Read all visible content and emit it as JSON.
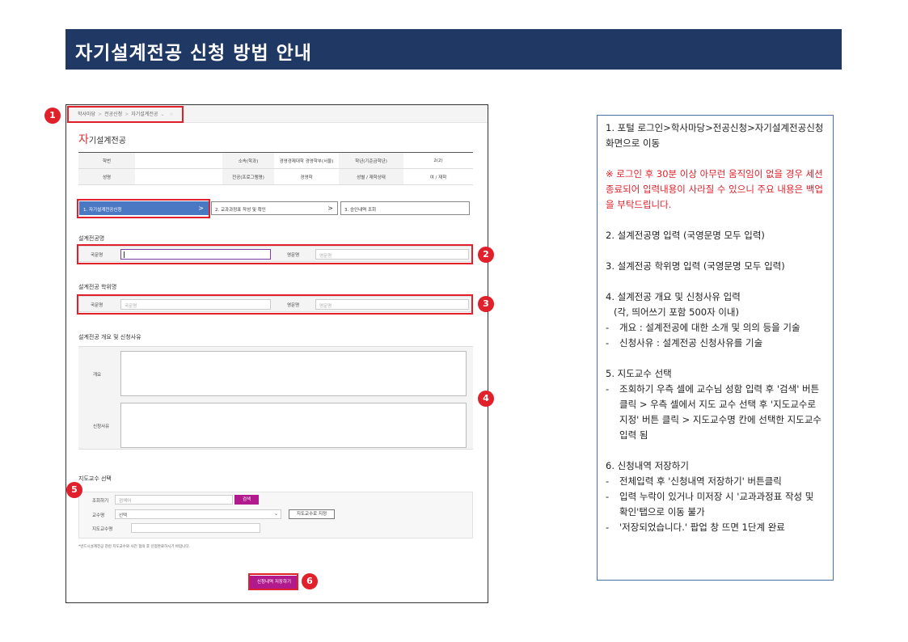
{
  "banner": {
    "title": "자기설계전공 신청 방법 안내"
  },
  "screenshot": {
    "breadcrumb": [
      "학사마당",
      "전공신청",
      "자기설계전공"
    ],
    "page_title": {
      "first": "자",
      "rest": "기설계전공"
    },
    "info": {
      "student_id_label": "학번",
      "affiliation_label": "소속(학과)",
      "affiliation_value": "경영경제대학 경영학부(서울)",
      "grade_label": "학년(기준금학년)",
      "grade_value": "2(2)",
      "name_label": "성명",
      "major_label": "전공(프로그램명)",
      "major_value": "경영학",
      "gender_label": "성별 / 재학상태",
      "gender_value": "여 / 재학"
    },
    "steps": [
      {
        "label": "1. 자기설계전공신청",
        "arrow": ">"
      },
      {
        "label": "2. 교과과정표 작성 및 확인",
        "arrow": ">"
      },
      {
        "label": "3. 승인내역 조회"
      }
    ],
    "major_name": {
      "section": "설계전공명",
      "kor_label": "국문명",
      "kor_value": "",
      "eng_label": "영문명",
      "eng_placeholder": "영문명"
    },
    "degree_name": {
      "section": "설계전공 학위명",
      "kor_label": "국문명",
      "kor_placeholder": "국문명",
      "eng_label": "영문명",
      "eng_placeholder": "영문명"
    },
    "overview": {
      "section": "설계전공 개요 및 신청사유",
      "overview_label": "개요",
      "reason_label": "신청사유"
    },
    "advisor": {
      "section": "지도교수 선택",
      "search_label": "조회하기",
      "search_placeholder": "검색어",
      "search_button": "검색",
      "professor_label": "교수명",
      "professor_select": "선택",
      "assign_button": "지도교수로 지정",
      "advisor_label": "지도교수명"
    },
    "note": "*반드시설계전공 관련 지도교수와 사전 협의 후 신청완료하시기 바랍니다.",
    "save_button": "신청내역 저장하기"
  },
  "badges": [
    "1",
    "2",
    "3",
    "4",
    "5",
    "6"
  ],
  "guide": {
    "s1": "1. 포털 로그인>학사마당>전공신청>자기설계전공신청 화면으로 이동",
    "warning": "※ 로그인 후 30분 이상 아무런 움직임이 없을 경우 세션 종료되어 입력내용이 사라질 수 있으니 주요 내용은 백업을 부탁드립니다.",
    "s2": "2. 설계전공명 입력 (국영문명 모두 입력)",
    "s3": "3. 설계전공 학위명 입력 (국영문명 모두 입력)",
    "s4_title": "4. 설계전공 개요 및 신청사유 입력",
    "s4_note": "(각, 띄어쓰기 포함 500자 이내)",
    "s4_b1": "개요 :  설계전공에 대한 소개 및 의의 등을 기술",
    "s4_b2": "신청사유 : 설계전공 신청사유를 기술",
    "s5_title": "5. 지도교수 선택",
    "s5_b1": "조회하기 우측 셀에 교수님 성함 입력 후 '검색' 버튼 클릭 > 우측 셀에서 지도 교수 선택 후 '지도교수로 지정' 버튼 클릭 > 지도교수명 칸에 선택한 지도교수 입력 됨",
    "s6_title": "6. 신청내역 저장하기",
    "s6_b1": "전체입력 후 '신청내역 저장하기' 버튼클릭",
    "s6_b2": "입력 누락이 있거나 미저장 시 '교과과정표 작성 및 확인'탭으로 이동 불가",
    "s6_b3": "'저장되었습니다.' 팝업 창 뜨면 1단계 완료",
    "dash": "-"
  }
}
